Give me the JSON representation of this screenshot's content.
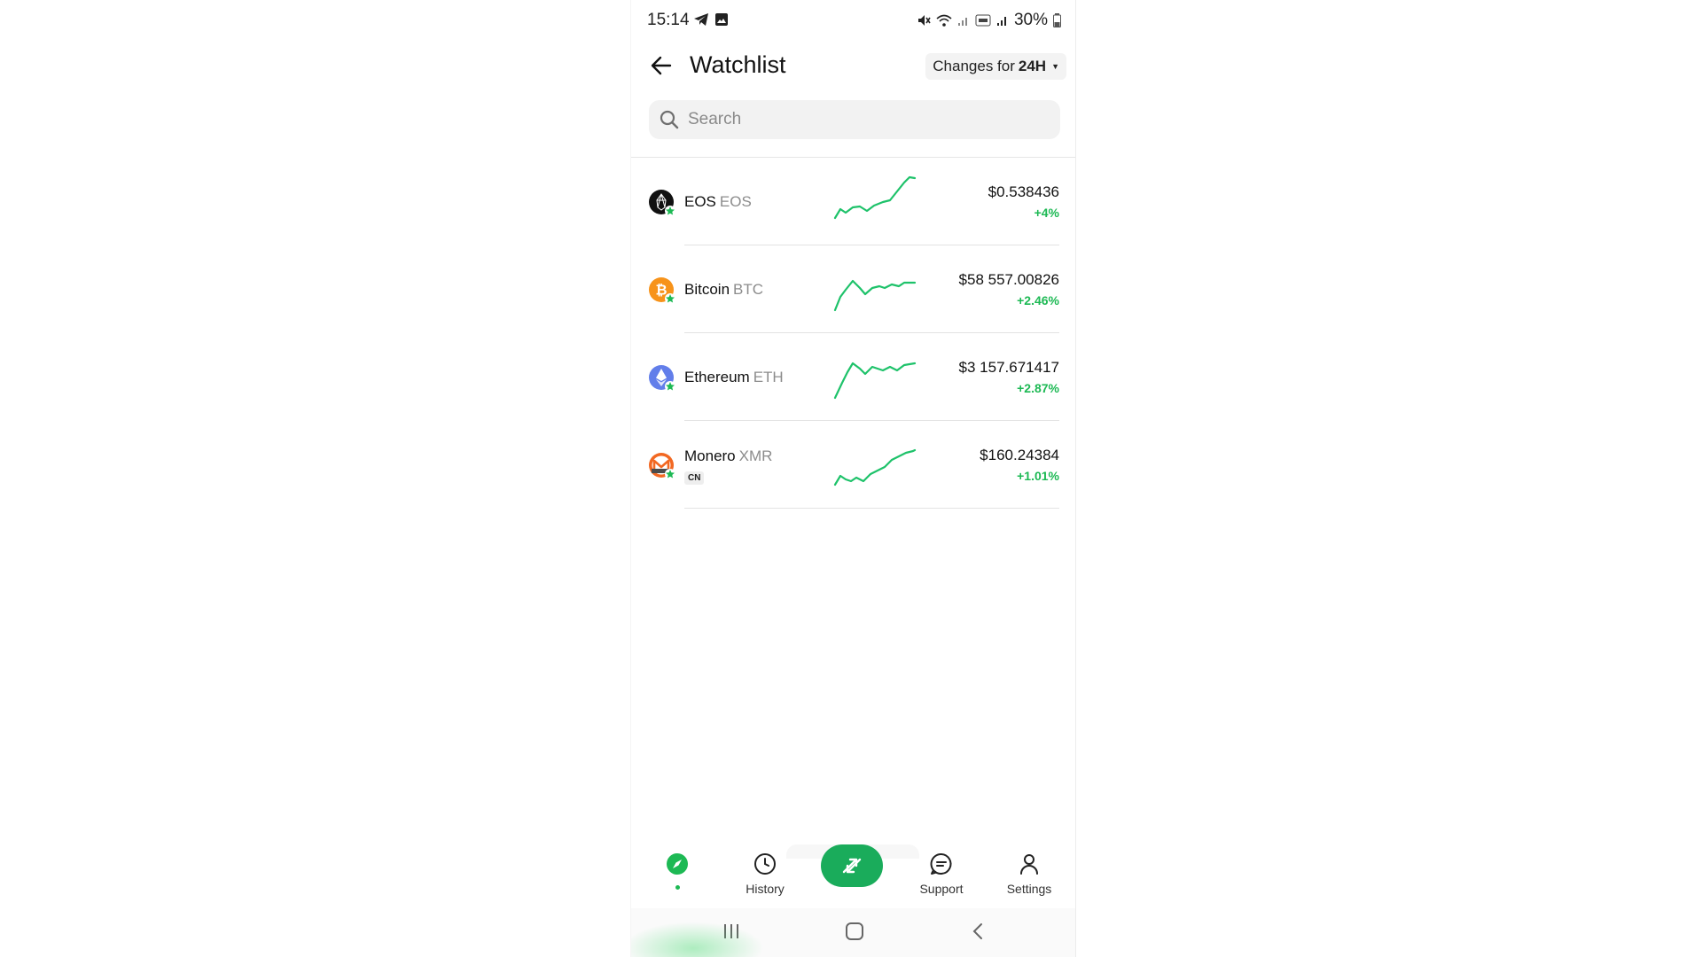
{
  "status_bar": {
    "time": "15:14",
    "battery": "30%",
    "left_icons": [
      "telegram-icon",
      "image-icon"
    ],
    "right_icons": [
      "mute-icon",
      "wifi-icon",
      "signal-icon",
      "volte-icon",
      "signal-icon",
      "battery-icon"
    ]
  },
  "header": {
    "title": "Watchlist",
    "changes_prefix": "Changes for",
    "changes_period": "24H"
  },
  "search": {
    "placeholder": "Search"
  },
  "coins": [
    {
      "name": "EOS",
      "symbol": "EOS",
      "price": "$0.538436",
      "change": "+4%",
      "badge": "",
      "icon": "eos-logo-icon",
      "color": "#111111"
    },
    {
      "name": "Bitcoin",
      "symbol": "BTC",
      "price": "$58 557.00826",
      "change": "+2.46%",
      "badge": "",
      "icon": "bitcoin-logo-icon",
      "color": "#f7931a"
    },
    {
      "name": "Ethereum",
      "symbol": "ETH",
      "price": "$3 157.671417",
      "change": "+2.87%",
      "badge": "",
      "icon": "ethereum-logo-icon",
      "color": "#627eea"
    },
    {
      "name": "Monero",
      "symbol": "XMR",
      "price": "$160.24384",
      "change": "+1.01%",
      "badge": "CN",
      "icon": "monero-logo-icon",
      "color": "#f26822"
    }
  ],
  "bottom_nav": {
    "history": "History",
    "support": "Support",
    "settings": "Settings"
  },
  "colors": {
    "accent": "#1db954",
    "exchange_button": "#1aac5b",
    "sparkline": "#1ec26a"
  }
}
